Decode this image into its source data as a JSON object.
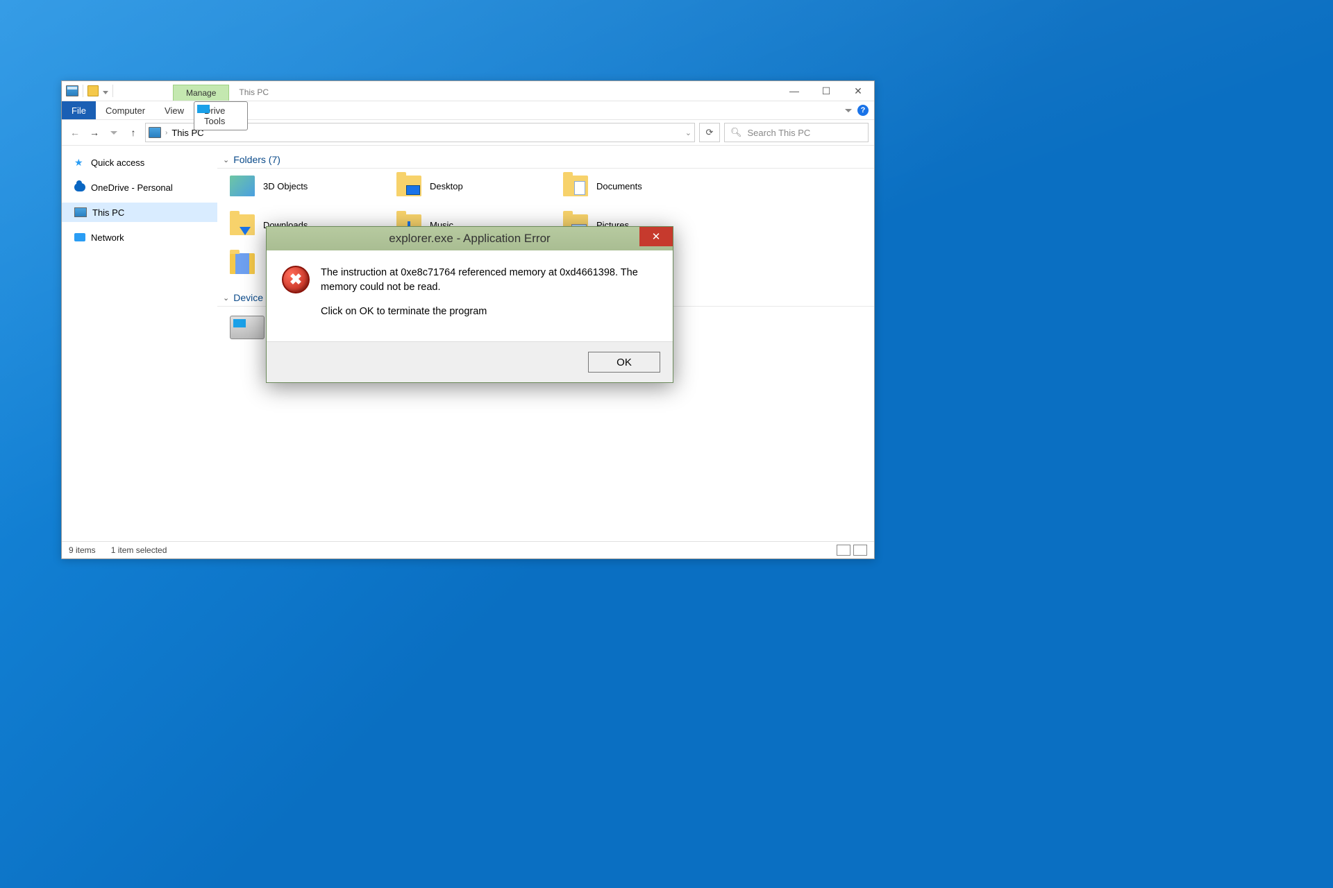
{
  "titlebar": {
    "context_tab": "Manage",
    "window_title": "This PC"
  },
  "ribbon": {
    "file": "File",
    "computer": "Computer",
    "view": "View",
    "drive_tools": "Drive Tools"
  },
  "nav": {
    "location": "This PC",
    "search_placeholder": "Search This PC"
  },
  "sidebar": {
    "quick_access": "Quick access",
    "onedrive": "OneDrive - Personal",
    "this_pc": "This PC",
    "network": "Network"
  },
  "content": {
    "folders_header": "Folders (7)",
    "devices_header": "Device",
    "folders": {
      "obj3d": "3D Objects",
      "desktop": "Desktop",
      "documents": "Documents",
      "downloads": "Downloads",
      "music": "Music",
      "pictures": "Pictures"
    }
  },
  "status": {
    "items": "9 items",
    "selected": "1 item selected"
  },
  "error": {
    "title": "explorer.exe - Application Error",
    "line1": "The instruction at 0xe8c71764 referenced memory at 0xd4661398. The memory could not be read.",
    "line2": "Click on OK to terminate the program",
    "ok": "OK"
  }
}
